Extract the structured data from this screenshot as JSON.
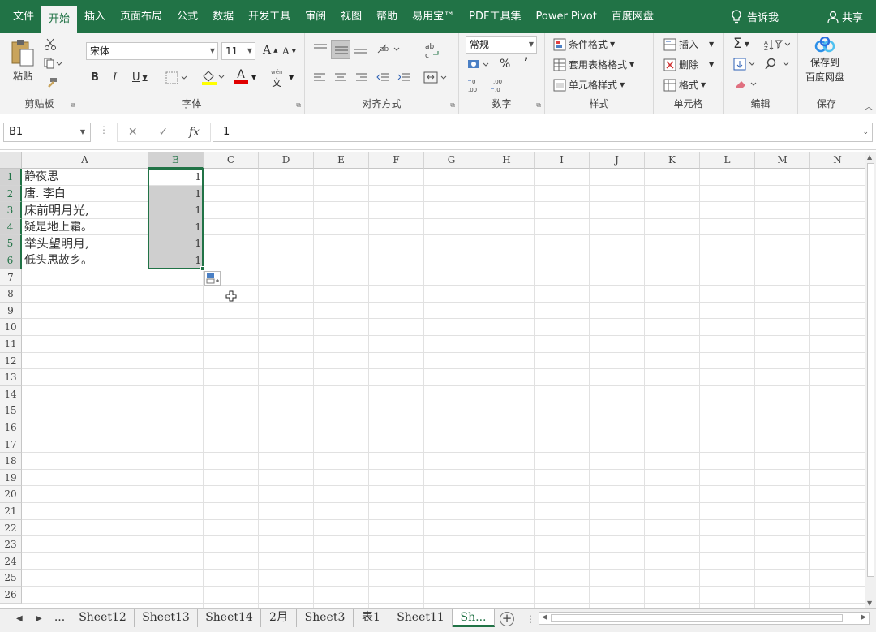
{
  "tabs": [
    "文件",
    "开始",
    "插入",
    "页面布局",
    "公式",
    "数据",
    "开发工具",
    "审阅",
    "视图",
    "帮助",
    "易用宝™",
    "PDF工具集",
    "Power Pivot",
    "百度网盘"
  ],
  "active_tab": "开始",
  "tell_me": "告诉我",
  "share": "共享",
  "ribbon": {
    "clipboard": {
      "paste": "粘贴",
      "label": "剪贴板"
    },
    "font": {
      "name": "宋体",
      "size": "11",
      "label": "字体",
      "grow": "A",
      "shrink": "A",
      "bold": "B",
      "italic": "I",
      "underline": "U",
      "font_color": "A",
      "wen": "文"
    },
    "align": {
      "label": "对齐方式"
    },
    "number": {
      "format": "常规",
      "percent": "%",
      "comma": "’",
      "label": "数字"
    },
    "styles": {
      "cond": "条件格式",
      "table": "套用表格格式",
      "cell": "单元格样式",
      "label": "样式"
    },
    "cells": {
      "insert": "插入",
      "delete": "删除",
      "format": "格式",
      "label": "单元格"
    },
    "edit": {
      "label": "编辑"
    },
    "save": {
      "line1": "保存到",
      "line2": "百度网盘",
      "label": "保存"
    }
  },
  "formula_bar": {
    "name_box": "B1",
    "fx": "fx",
    "value": "1"
  },
  "columns": [
    "A",
    "B",
    "C",
    "D",
    "E",
    "F",
    "G",
    "H",
    "I",
    "J",
    "K",
    "L",
    "M",
    "N"
  ],
  "rows": [
    "1",
    "2",
    "3",
    "4",
    "5",
    "6",
    "7",
    "8",
    "9",
    "10",
    "11",
    "12",
    "13",
    "14",
    "15",
    "16",
    "17",
    "18",
    "19",
    "20",
    "21",
    "22",
    "23",
    "24",
    "25",
    "26"
  ],
  "cells_a": [
    "静夜思",
    "唐. 李白",
    "床前明月光,",
    "疑是地上霜。",
    "举头望明月,",
    "低头思故乡。"
  ],
  "cells_b": [
    "1",
    "1",
    "1",
    "1",
    "1",
    "1"
  ],
  "sheets": [
    "...",
    "Sheet12",
    "Sheet13",
    "Sheet14",
    "2月",
    "Sheet3",
    "表1",
    "Sheet11",
    "Sh..."
  ],
  "active_sheet": "Sh...",
  "colors": {
    "accent": "#217346",
    "selection": "#cfcfcf"
  }
}
